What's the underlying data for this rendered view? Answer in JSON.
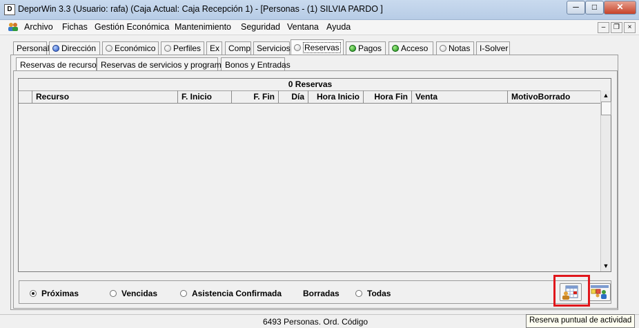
{
  "window": {
    "title": "DeporWin 3.3  (Usuario: rafa)  (Caja Actual: Caja Recepción 1) - [Personas - (1) SILVIA PARDO ]",
    "app_icon_letter": "D"
  },
  "menu": {
    "items": [
      "Archivo",
      "Fichas",
      "Gestión Económica",
      "Mantenimiento",
      "Seguridad",
      "Ventana",
      "Ayuda"
    ]
  },
  "tabs": [
    {
      "label": "Personal",
      "dot": "none"
    },
    {
      "label": "Dirección",
      "dot": "blue"
    },
    {
      "label": "Económico",
      "dot": "grey"
    },
    {
      "label": "Perfiles",
      "dot": "grey"
    },
    {
      "label": "Ex",
      "dot": "none"
    },
    {
      "label": "Comp",
      "dot": "none"
    },
    {
      "label": "Servicios",
      "dot": "none"
    },
    {
      "label": "Reservas",
      "dot": "grey",
      "active": true
    },
    {
      "label": "Pagos",
      "dot": "green"
    },
    {
      "label": "Acceso",
      "dot": "green"
    },
    {
      "label": "Notas",
      "dot": "grey"
    },
    {
      "label": "I-Solver",
      "dot": "none"
    }
  ],
  "subtabs": [
    "Reservas de recursos",
    "Reservas de servicios y programas",
    "Bonos y Entradas"
  ],
  "grid": {
    "title": "0 Reservas",
    "columns": [
      "Recurso",
      "F. Inicio",
      "F. Fin",
      "Día",
      "Hora Inicio",
      "Hora Fin",
      "Venta",
      "MotivoBorrado"
    ]
  },
  "filters": {
    "options": [
      "Próximas",
      "Vencidas",
      "Asistencia Confirmada",
      "Borradas",
      "Todas"
    ],
    "selected": "Próximas"
  },
  "status": {
    "text": "6493 Personas. Ord. Código"
  },
  "tooltip": {
    "text": "Reserva puntual de actividad"
  },
  "colors": {
    "highlight": "#e0161b",
    "active_green": "#128a12",
    "active_blue": "#1f4fc3"
  }
}
